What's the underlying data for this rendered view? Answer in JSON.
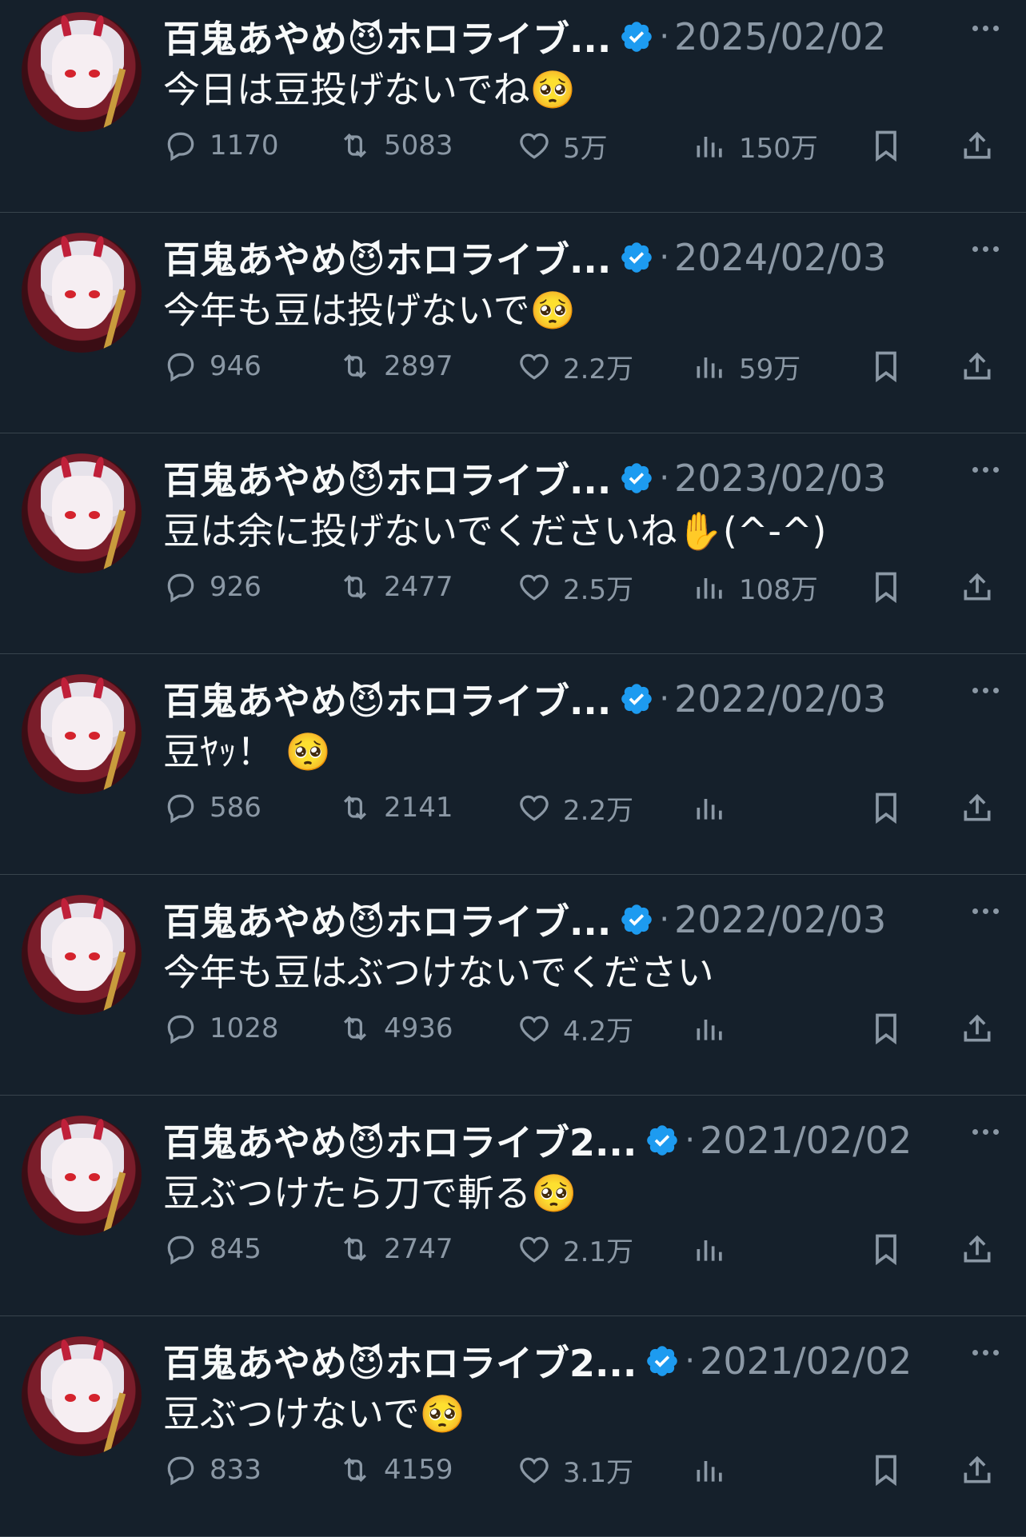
{
  "tweets": [
    {
      "name": "百鬼あやめ😈ホロライブ...",
      "date": "2025/02/02",
      "text": "今日は豆投げないでね🥺",
      "replies": "1170",
      "retweets": "5083",
      "likes": "5万",
      "views": "150万"
    },
    {
      "name": "百鬼あやめ😈ホロライブ...",
      "date": "2024/02/03",
      "text": "今年も豆は投げないで🥺",
      "replies": "946",
      "retweets": "2897",
      "likes": "2.2万",
      "views": "59万"
    },
    {
      "name": "百鬼あやめ😈ホロライブ...",
      "date": "2023/02/03",
      "text": "豆は余に投げないでくださいね✋(^-^)",
      "replies": "926",
      "retweets": "2477",
      "likes": "2.5万",
      "views": "108万"
    },
    {
      "name": "百鬼あやめ😈ホロライブ...",
      "date": "2022/02/03",
      "text": "豆ﾔｯ！ 🥺",
      "replies": "586",
      "retweets": "2141",
      "likes": "2.2万",
      "views": ""
    },
    {
      "name": "百鬼あやめ😈ホロライブ...",
      "date": "2022/02/03",
      "text": "今年も豆はぶつけないでください",
      "replies": "1028",
      "retweets": "4936",
      "likes": "4.2万",
      "views": ""
    },
    {
      "name": "百鬼あやめ😈ホロライブ2...",
      "date": "2021/02/02",
      "text": "豆ぶつけたら刀で斬る🥺",
      "replies": "845",
      "retweets": "2747",
      "likes": "2.1万",
      "views": ""
    },
    {
      "name": "百鬼あやめ😈ホロライブ2...",
      "date": "2021/02/02",
      "text": "豆ぶつけないで🥺",
      "replies": "833",
      "retweets": "4159",
      "likes": "3.1万",
      "views": ""
    }
  ],
  "icons": {
    "reply": "reply-icon",
    "retweet": "retweet-icon",
    "like": "heart-icon",
    "views": "views-icon",
    "bookmark": "bookmark-icon",
    "share": "share-icon",
    "more": "more-icon",
    "verified": "verified-badge-icon"
  },
  "colors": {
    "background": "#15202b",
    "text": "#f7f9f9",
    "muted": "#8b98a5",
    "verified": "#1d9bf0",
    "divider": "#38444d"
  }
}
